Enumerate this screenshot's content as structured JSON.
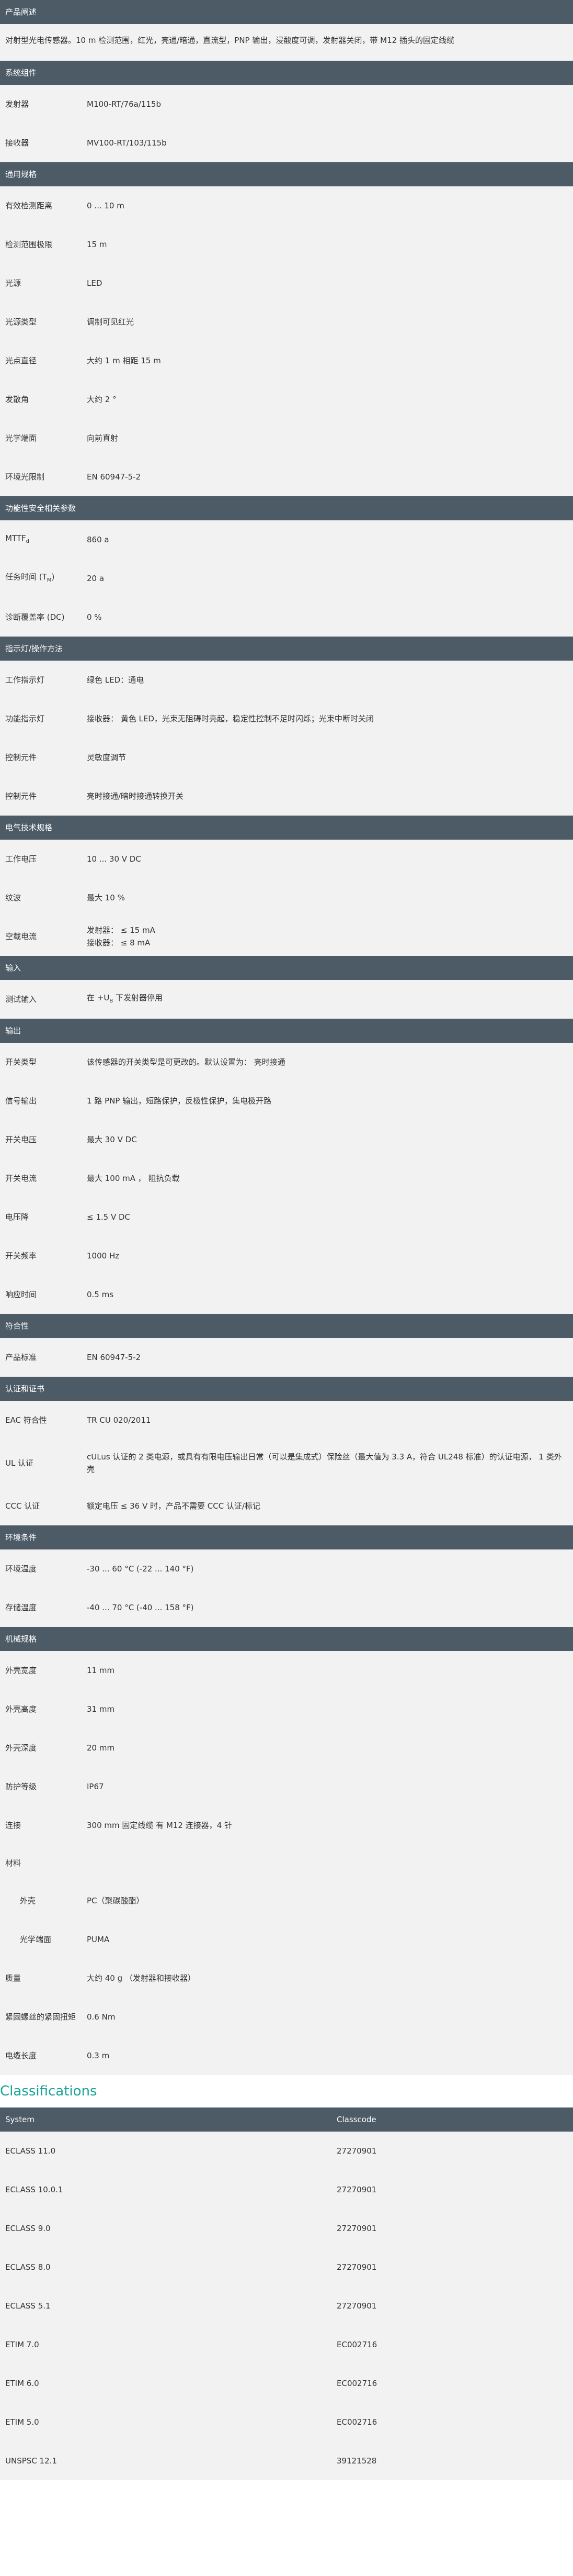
{
  "description": {
    "title": "产品阐述",
    "text": "对射型光电传感器。10 m 检测范围，红光，亮通/暗通，直流型，PNP 输出，浸酸度可调，发射器关闭，带 M12 插头的固定线缆"
  },
  "sections": [
    {
      "title": "系统组件",
      "rows": [
        {
          "label": "发射器",
          "value": "M100-RT/76a/115b"
        },
        {
          "label": "接收器",
          "value": "MV100-RT/103/115b"
        }
      ]
    },
    {
      "title": "通用规格",
      "rows": [
        {
          "label": "有效检测距离",
          "value": "0 ... 10 m"
        },
        {
          "label": "检测范围极限",
          "value": "15 m"
        },
        {
          "label": "光源",
          "value": "LED"
        },
        {
          "label": "光源类型",
          "value": "调制可见红光"
        },
        {
          "label": "光点直径",
          "value": "大约 1 m 相距 15 m"
        },
        {
          "label": "发散角",
          "value": "大约 2 °"
        },
        {
          "label": "光学端面",
          "value": "向前直射"
        },
        {
          "label": "环境光限制",
          "value": "EN 60947-5-2"
        }
      ]
    },
    {
      "title": "功能性安全相关参数",
      "rows": [
        {
          "label": "MTTF",
          "label_sub": "d",
          "value": "860 a"
        },
        {
          "label": "任务时间 (T",
          "label_sub": "M",
          "label_tail": ")",
          "value": "20 a"
        },
        {
          "label": "诊断覆盖率 (DC)",
          "value": "0 %"
        }
      ]
    },
    {
      "title": "指示灯/操作方法",
      "rows": [
        {
          "label": "工作指示灯",
          "value": "绿色 LED：通电"
        },
        {
          "label": "功能指示灯",
          "value": "接收器： 黄色 LED，光束无阻碍时亮起，稳定性控制不足时闪烁；光束中断时关闭"
        },
        {
          "label": "控制元件",
          "value": "灵敏度调节"
        },
        {
          "label": "控制元件",
          "value": "亮时接通/暗时接通转换开关"
        }
      ]
    },
    {
      "title": "电气技术规格",
      "rows": [
        {
          "label": "工作电压",
          "value": "10 ... 30 V DC"
        },
        {
          "label": "纹波",
          "value": "最大 10 %"
        },
        {
          "label": "空载电流",
          "lines": [
            "发射器： ≤ 15 mA",
            "接收器： ≤ 8 mA"
          ]
        }
      ]
    },
    {
      "title": "输入",
      "rows": [
        {
          "label": "测试输入",
          "value": "在 +U",
          "value_sub": "B",
          "value_tail": " 下发射器停用"
        }
      ]
    },
    {
      "title": "输出",
      "rows": [
        {
          "label": "开关类型",
          "value": "该传感器的开关类型是可更改的。默认设置为： 亮时接通"
        },
        {
          "label": "信号输出",
          "value": "1 路 PNP 输出，短路保护，反极性保护，集电极开路"
        },
        {
          "label": "开关电压",
          "value": "最大 30 V DC"
        },
        {
          "label": "开关电流",
          "value": "最大 100 mA ， 阻抗负载"
        },
        {
          "label": "电压降",
          "value": "≤ 1.5 V DC"
        },
        {
          "label": "开关频率",
          "value": "1000 Hz"
        },
        {
          "label": "响应时间",
          "value": "0.5 ms"
        }
      ]
    },
    {
      "title": "符合性",
      "rows": [
        {
          "label": "产品标准",
          "value": "EN 60947-5-2"
        }
      ]
    },
    {
      "title": "认证和证书",
      "rows": [
        {
          "label": "EAC 符合性",
          "value": "TR CU 020/2011"
        },
        {
          "label": "UL 认证",
          "value": "cULus 认证的 2 类电源，或具有有限电压输出日常（可以是集成式）保险丝（最大值为 3.3 A，符合 UL248 标准）的认证电源， 1 类外壳",
          "tall": true
        },
        {
          "label": "CCC 认证",
          "value": "额定电压 ≤ 36 V 时，产品不需要 CCC 认证/标记"
        }
      ]
    },
    {
      "title": "环境条件",
      "rows": [
        {
          "label": "环境温度",
          "value": "-30 ... 60 °C (-22 ... 140 °F)"
        },
        {
          "label": "存储温度",
          "value": "-40 ... 70 °C (-40 ... 158 °F)"
        }
      ]
    },
    {
      "title": "机械规格",
      "rows": [
        {
          "label": "外壳宽度",
          "value": "11 mm"
        },
        {
          "label": "外壳高度",
          "value": "31 mm"
        },
        {
          "label": "外壳深度",
          "value": "20 mm"
        },
        {
          "label": "防护等级",
          "value": "IP67"
        },
        {
          "label": "连接",
          "value": "300 mm 固定线缆 有 M12 连接器，4 针"
        },
        {
          "label": "材料",
          "value": "",
          "group": true
        },
        {
          "label": "外壳",
          "value": "PC（聚碳酸酯）",
          "sub": true
        },
        {
          "label": "光学端面",
          "value": "PUMA",
          "sub": true
        },
        {
          "label": "质量",
          "value": "大约 40 g （发射器和接收器）"
        },
        {
          "label": "紧固螺丝的紧固扭矩",
          "value": "0.6 Nm"
        },
        {
          "label": "电缆长度",
          "value": "0.3 m"
        }
      ]
    }
  ],
  "classifications": {
    "title": "Classifications",
    "header": {
      "system": "System",
      "classcode": "Classcode"
    },
    "rows": [
      {
        "system": "ECLASS 11.0",
        "code": "27270901"
      },
      {
        "system": "ECLASS 10.0.1",
        "code": "27270901"
      },
      {
        "system": "ECLASS 9.0",
        "code": "27270901"
      },
      {
        "system": "ECLASS 8.0",
        "code": "27270901"
      },
      {
        "system": "ECLASS 5.1",
        "code": "27270901"
      },
      {
        "system": "ETIM 7.0",
        "code": "EC002716"
      },
      {
        "system": "ETIM 6.0",
        "code": "EC002716"
      },
      {
        "system": "ETIM 5.0",
        "code": "EC002716"
      },
      {
        "system": "UNSPSC 12.1",
        "code": "39121528"
      }
    ]
  }
}
